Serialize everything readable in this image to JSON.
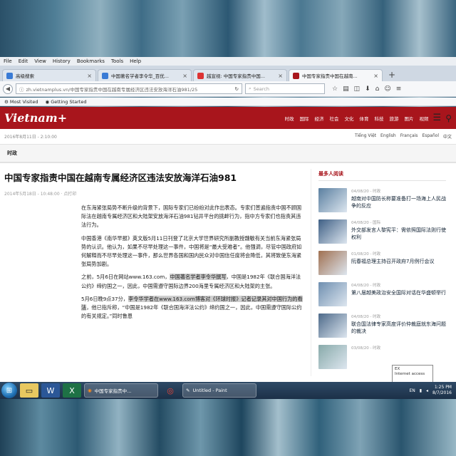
{
  "menubar": {
    "items": [
      "File",
      "Edit",
      "View",
      "History",
      "Bookmarks",
      "Tools",
      "Help"
    ]
  },
  "tabs": [
    {
      "label": "高级搜索",
      "color": "#3a7bd5",
      "active": false
    },
    {
      "label": "中国著名学者李令华_百优...",
      "color": "#3a7bd5",
      "active": false
    },
    {
      "label": "越宣视: 中国专家指责中国...",
      "color": "#d33",
      "active": false
    },
    {
      "label": "中国专家指责中国在越南...",
      "color": "#a8151c",
      "active": true
    }
  ],
  "newtab_label": "+",
  "address": {
    "url": "zh.vietnamplus.vn/中国专家指责中国在越南专属经济区违法安放海洋石油981/25",
    "search_placeholder": "Search"
  },
  "bookmarks": {
    "items": [
      "Most Visited",
      "Getting Started"
    ]
  },
  "site": {
    "logo": "Vietnam+",
    "nav": [
      "时政",
      "国际",
      "经济",
      "社会",
      "文化",
      "体育",
      "科技",
      "旅游",
      "图片",
      "视频"
    ],
    "dateline": "2016年8月11日 - 2:10:00",
    "languages": [
      "Tiếng Việt",
      "English",
      "Français",
      "Español",
      "中文"
    ],
    "section": "时政"
  },
  "article": {
    "headline": "中国专家指责中国在越南专属经济区违法安放海洋石油981",
    "meta": "2014年5月18日 - 10:48:00 · 点打印",
    "p1": "在东海紧张局势不断升级的背景下，国际专家们已纷纷对此作出表态。专家们普遍指责中国不顾国际法在越南专属经济区和大陆架安放海洋石油981钻井平台的挑衅行为，指中方专家们也指责其违法行为。",
    "p2": "中国香港《南华早报》英文版5月11日刊登了北京大学世界研究所副教授魏敏有关当前东海紧张局势的认识。他认为，如果不尽早处理这一事件，中国将是“最大受难者”。他强调，尽管中国政府如何解释而不尽早处理这一事件，那么世界各国和国内民众对中国信任度将会降低，其将致使东海紧张局势加剧。",
    "p3a": "之前，5月6日在网站www.163.com，",
    "p3hl": "中国著名学者李令华撰写",
    "p3b": "，中国是1982年《联合国海洋法公约》缔约国之一，因此，中国需遵守国际边界200海里专属经济区和大陆架的主张。",
    "p4a": "5月6日晚9点37分，",
    "p4hl": "李令华学者在www.163.com博客对《环球时报》记者记录其对中国行为的看法",
    "p4b": "，他已指斥称，“中国是1982年《联合国海洋法公约》缔约国之一，因此，中国需遵守国际公约的有关规定。”同时鲁恩"
  },
  "sidebar": {
    "title": "最多人阅读",
    "items": [
      {
        "date": "04/08/20 - 时政",
        "text": "越南对中国防长称要准备打一场海上人民战争的反应",
        "color": "#5a7fa0"
      },
      {
        "date": "04/08/20 - 国际",
        "text": "外交部发言人黎宪平：需依照国际法则行使权利",
        "color": "#3e5f85"
      },
      {
        "date": "01/08/20 - 时政",
        "text": "阮春福总理主持召开政府7月例行会议",
        "color": "#a07050"
      },
      {
        "date": "04/08/20 - 时政",
        "text": "第八届越美政治安全国际对话在华盛顿举行",
        "color": "#6f8fb0"
      },
      {
        "date": "04/08/20 - 时政",
        "text": "联合国法律专家高度评价仲裁庭就东海问题的裁决",
        "color": "#4d6a8a"
      },
      {
        "date": "03/08/20 - 时政",
        "text": "",
        "color": "#8aa"
      }
    ]
  },
  "tooltip": {
    "line1": "EX",
    "line2": "Internet access"
  },
  "taskbar": {
    "windows": [
      {
        "label": "中国专家指责中...",
        "icon": "firefox-icon"
      },
      {
        "label": "Untitled - Paint",
        "icon": "paint-icon"
      }
    ],
    "lang": "EN",
    "time": "1:25 PM",
    "date": "8/7/2016"
  }
}
